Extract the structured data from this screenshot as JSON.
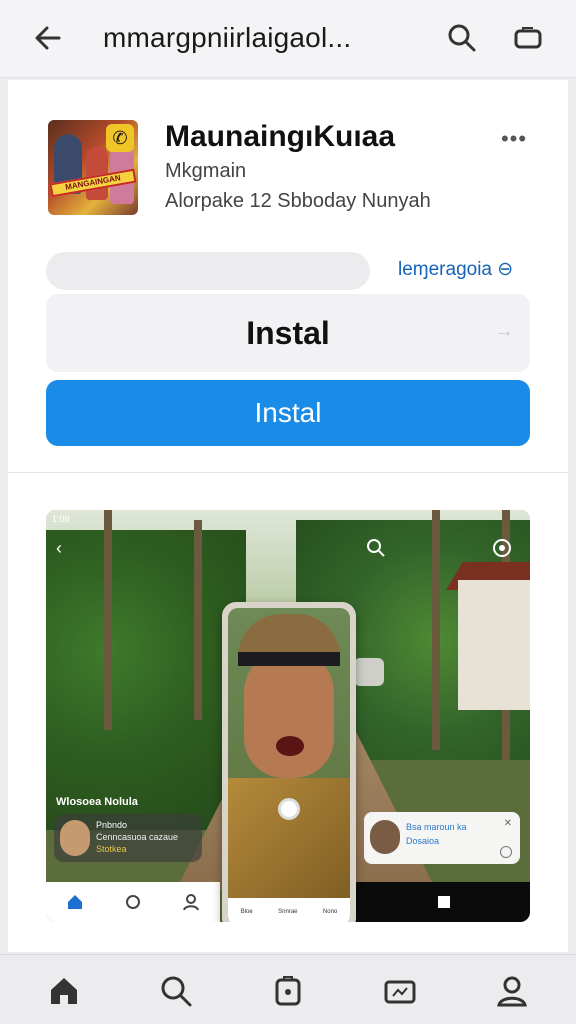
{
  "topbar": {
    "title": "mmargpniirlaigaol...",
    "back_icon": "arrow-left-icon",
    "search_icon": "search-icon",
    "tabs_icon": "tabs-icon"
  },
  "app": {
    "name": "MaunaingıKuıaa",
    "developer": "Mkgmain",
    "meta": "Alorpake 12 Sbboday Nunyah",
    "more_icon": "more-horizontal-icon",
    "icon_banner_text": "MANGAINGAN"
  },
  "actions": {
    "link_text": "leɱeragoia ⊖",
    "install_box_label": "Instal",
    "install_button_label": "Instal",
    "accent_color": "#1a8be6"
  },
  "screenshot": {
    "status_text": "1:08",
    "overlay_name": "Wlosoea Nolula",
    "overlay_card": {
      "line1": "Pnbndo",
      "line2": "Cenncasuoa cazaue",
      "line3": "Stotkea"
    },
    "right_card": {
      "line1": "Bsa maroun ka",
      "line2": "Dosaioa"
    },
    "phone_nav": [
      "Bloe",
      "Snnrae",
      "Nono"
    ]
  },
  "bottom_nav": {
    "items": [
      {
        "icon": "home-icon",
        "label": "Home"
      },
      {
        "icon": "search-icon",
        "label": "Search"
      },
      {
        "icon": "apps-icon",
        "label": "Apps"
      },
      {
        "icon": "games-icon",
        "label": "Games"
      },
      {
        "icon": "profile-icon",
        "label": "Profile"
      }
    ]
  }
}
